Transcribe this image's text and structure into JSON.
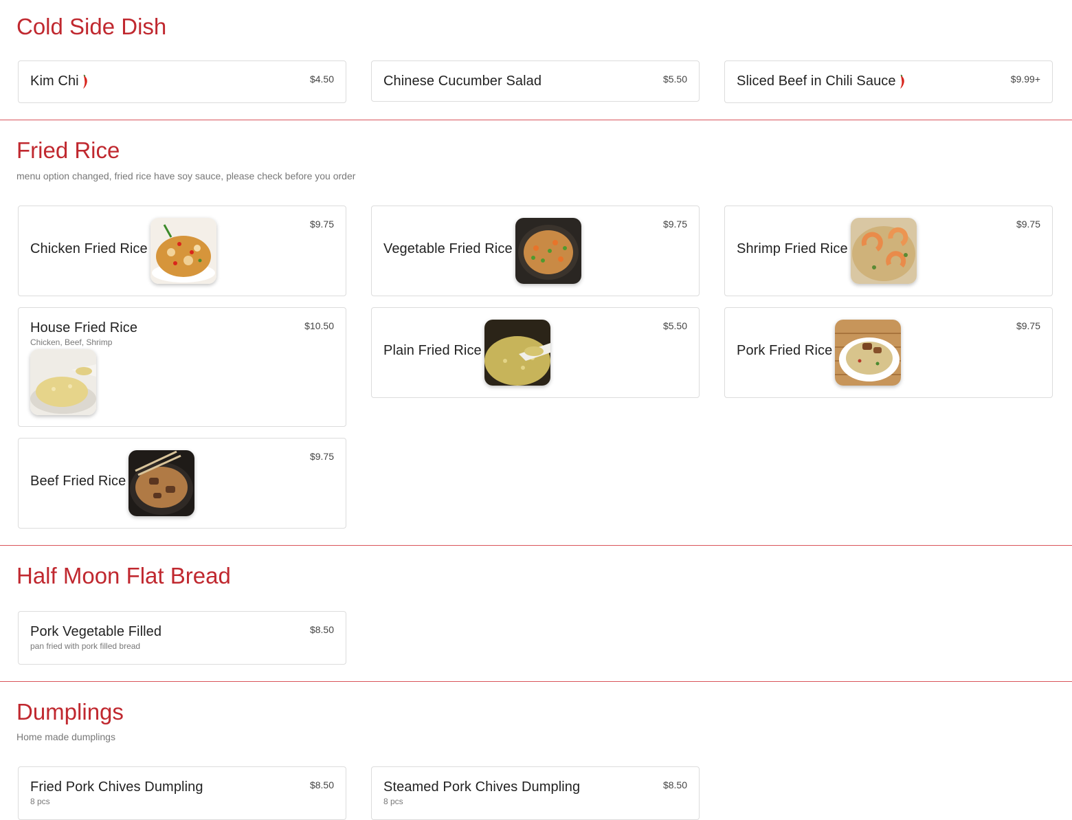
{
  "sections": [
    {
      "title": "Cold Side Dish",
      "subtitle": "",
      "items": [
        {
          "name": "Kim Chi",
          "price": "$4.50",
          "spicy": true
        },
        {
          "name": "Chinese Cucumber Salad",
          "price": "$5.50"
        },
        {
          "name": "Sliced Beef in Chili Sauce",
          "price": "$9.99+",
          "spicy": true
        }
      ]
    },
    {
      "title": "Fried Rice",
      "subtitle": "menu option changed, fried rice have soy sauce, please check before you order",
      "items": [
        {
          "name": "Chicken Fried Rice",
          "price": "$9.75",
          "image": "chicken-fried-rice-photo"
        },
        {
          "name": "Vegetable Fried Rice",
          "price": "$9.75",
          "image": "vegetable-fried-rice-photo"
        },
        {
          "name": "Shrimp Fried Rice",
          "price": "$9.75",
          "image": "shrimp-fried-rice-photo"
        },
        {
          "name": "House Fried Rice",
          "description": "Chicken, Beef, Shrimp",
          "price": "$10.50",
          "image": "house-fried-rice-photo"
        },
        {
          "name": "Plain Fried Rice",
          "price": "$5.50",
          "image": "plain-fried-rice-photo"
        },
        {
          "name": "Pork Fried Rice",
          "price": "$9.75",
          "image": "pork-fried-rice-photo"
        },
        {
          "name": "Beef Fried Rice",
          "price": "$9.75",
          "image": "beef-fried-rice-photo"
        }
      ]
    },
    {
      "title": "Half Moon Flat Bread",
      "subtitle": "",
      "items": [
        {
          "name": "Pork Vegetable Filled",
          "description": "pan fried with pork filled bread",
          "price": "$8.50"
        }
      ]
    },
    {
      "title": "Dumplings",
      "subtitle": "Home made dumplings",
      "items": [
        {
          "name": "Fried Pork Chives Dumpling",
          "description": "8 pcs",
          "price": "$8.50"
        },
        {
          "name": "Steamed Pork Chives Dumpling",
          "description": "8 pcs",
          "price": "$8.50"
        }
      ]
    }
  ],
  "colors": {
    "accent": "#c0282f",
    "divider": "#d9535a",
    "card_border": "#dcdcdc"
  },
  "icons": {
    "spicy": "chili-pepper-icon"
  }
}
